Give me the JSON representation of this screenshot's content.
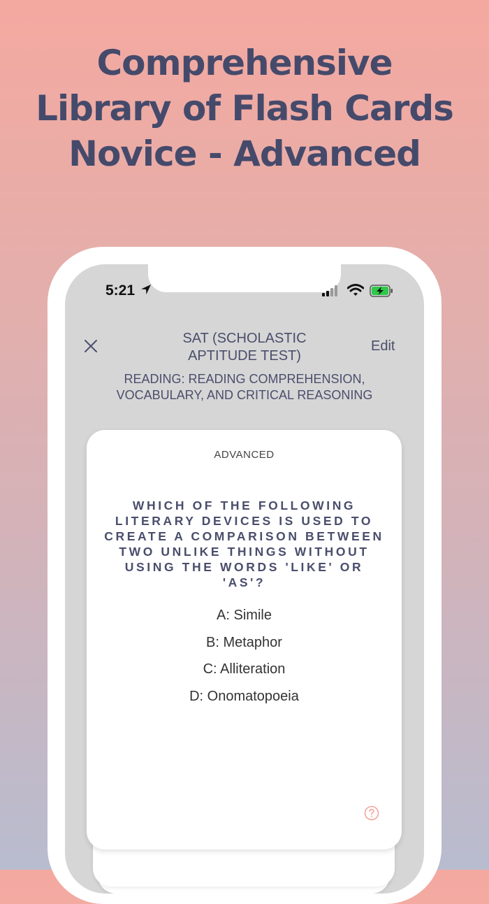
{
  "headline": {
    "line1": "Comprehensive",
    "line2": "Library of Flash Cards",
    "line3": "Novice - Advanced"
  },
  "status_bar": {
    "time": "5:21"
  },
  "nav": {
    "title": "SAT (SCHOLASTIC APTITUDE TEST)",
    "edit_label": "Edit",
    "subtitle": "READING: READING COMPREHENSION, VOCABULARY, AND CRITICAL REASONING"
  },
  "card": {
    "level": "ADVANCED",
    "question": "WHICH OF THE FOLLOWING LITERARY DEVICES IS USED TO CREATE A COMPARISON BETWEEN TWO UNLIKE THINGS WITHOUT USING THE WORDS 'LIKE' OR 'AS'?",
    "options": [
      "A: Simile",
      "B: Metaphor",
      "C: Alliteration",
      "D: Onomatopoeia"
    ]
  },
  "colors": {
    "accent_text": "#4a4e6c",
    "help_icon": "#f2a49a",
    "battery_green": "#2ec94a"
  },
  "icons": [
    "location-arrow-icon",
    "signal-icon",
    "wifi-icon",
    "battery-charging-icon",
    "close-icon",
    "help-circle-icon"
  ]
}
